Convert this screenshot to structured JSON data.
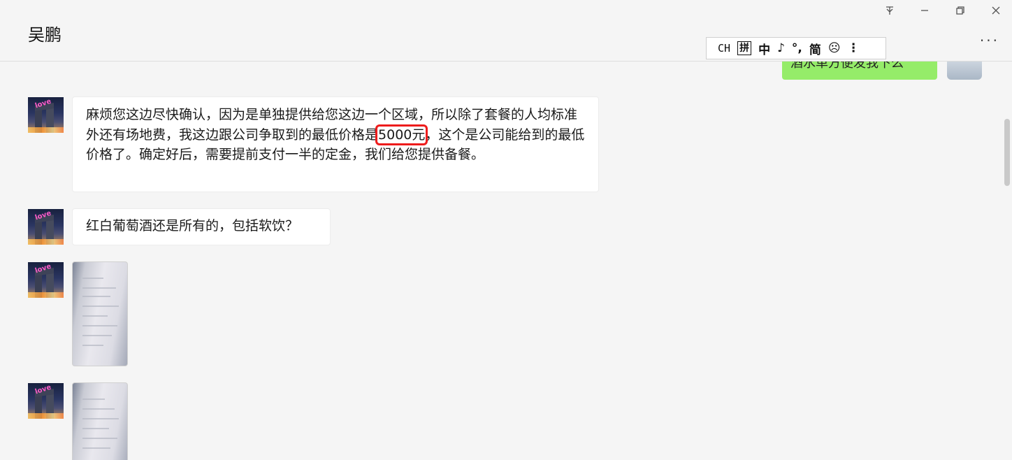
{
  "window": {
    "title": "吴鹏",
    "controls": {
      "pin_icon": "pin-icon",
      "minimize_icon": "minimize-icon",
      "restore_icon": "restore-icon",
      "close_icon": "close-icon"
    },
    "more_label": "···"
  },
  "ime_toolbar": {
    "ch": "CH",
    "pin": "拼",
    "lang": "中",
    "moon": "♪",
    "punct": "°,",
    "simp": "简",
    "emoji": "☹",
    "menu": "⋮"
  },
  "conversation": {
    "my_partial_message": "酒水单方便发我下么",
    "messages": [
      {
        "text_before": "麻烦您这边尽快确认，因为是单独提供给您这边一个区域，所以除了套餐的人均标准外还有场地费，我这边跟公司争取到的最低价格是",
        "highlight": "5000元",
        "text_after": "，这个是公司能给到的最低价格了。确定好后，需要提前支付一半的定金，我们给您提供备餐。"
      },
      {
        "text": "红白葡萄酒还是所有的，包括软饮？"
      }
    ]
  },
  "colors": {
    "my_bubble": "#95ec69",
    "highlight_border": "#ee1c1c",
    "background": "#f5f5f5"
  }
}
